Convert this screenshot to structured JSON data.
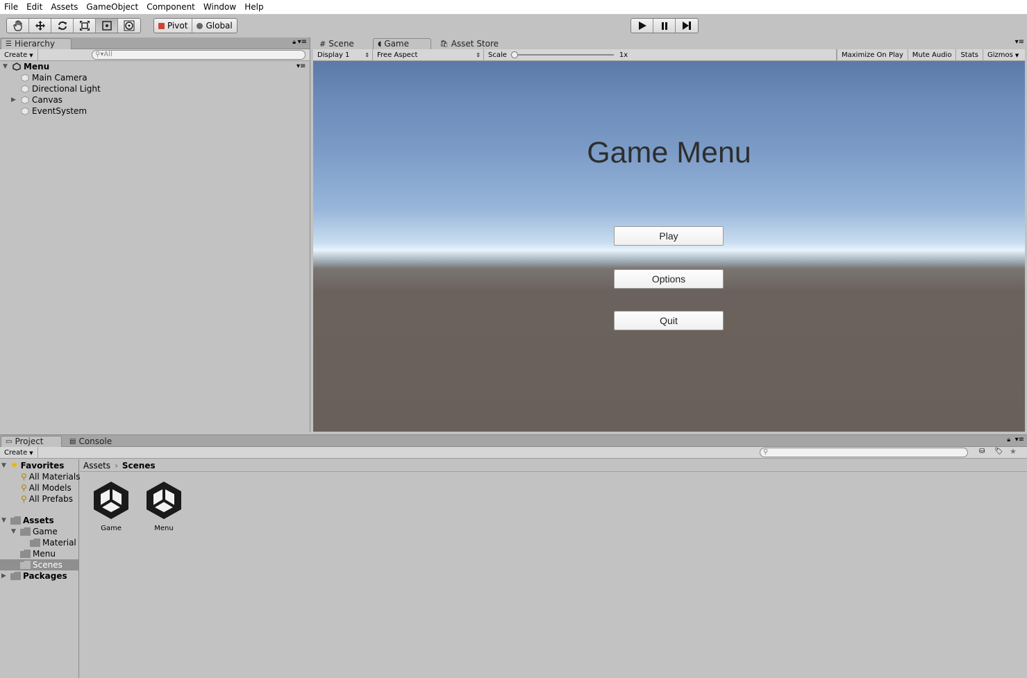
{
  "menubar": [
    "File",
    "Edit",
    "Assets",
    "GameObject",
    "Component",
    "Window",
    "Help"
  ],
  "toolbar": {
    "pivot_label": "Pivot",
    "global_label": "Global"
  },
  "hierarchy": {
    "tab_label": "Hierarchy",
    "create_label": "Create",
    "search_placeholder": "All",
    "scene_name": "Menu",
    "items": [
      "Main Camera",
      "Directional Light",
      "Canvas",
      "EventSystem"
    ]
  },
  "gameview": {
    "tabs": [
      "Scene",
      "Game",
      "Asset Store"
    ],
    "display": "Display 1",
    "aspect": "Free Aspect",
    "scale_label": "Scale",
    "scale_value": "1x",
    "options": [
      "Maximize On Play",
      "Mute Audio",
      "Stats",
      "Gizmos"
    ],
    "title": "Game Menu",
    "buttons": [
      "Play",
      "Options",
      "Quit"
    ]
  },
  "project": {
    "tabs": [
      "Project",
      "Console"
    ],
    "create_label": "Create",
    "favorites_label": "Favorites",
    "favorites": [
      "All Materials",
      "All Models",
      "All Prefabs"
    ],
    "assets_label": "Assets",
    "folders": {
      "game": "Game",
      "material": "Material",
      "menu": "Menu",
      "scenes": "Scenes"
    },
    "packages_label": "Packages",
    "breadcrumb": [
      "Assets",
      "Scenes"
    ],
    "assets": [
      "Game",
      "Menu"
    ]
  }
}
